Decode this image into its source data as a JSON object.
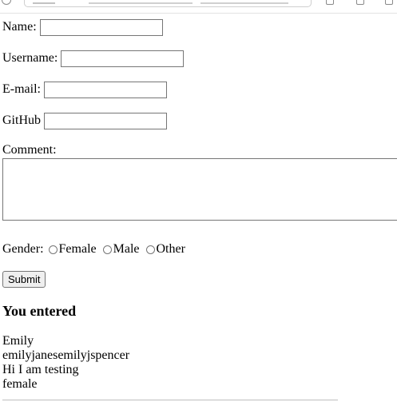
{
  "form": {
    "name_label": "Name:",
    "name_value": "",
    "username_label": "Username:",
    "username_value": "",
    "email_label": "E-mail:",
    "email_value": "",
    "github_label": "GitHub",
    "github_value": "",
    "comment_label": "Comment:",
    "comment_value": "",
    "gender_label": "Gender:",
    "gender_options": [
      "Female",
      "Male",
      "Other"
    ],
    "submit_label": "Submit"
  },
  "result": {
    "heading": "You entered",
    "lines": [
      "Emily",
      "emilyjanesemilyjspencer",
      "Hi I am testing",
      "female"
    ]
  }
}
